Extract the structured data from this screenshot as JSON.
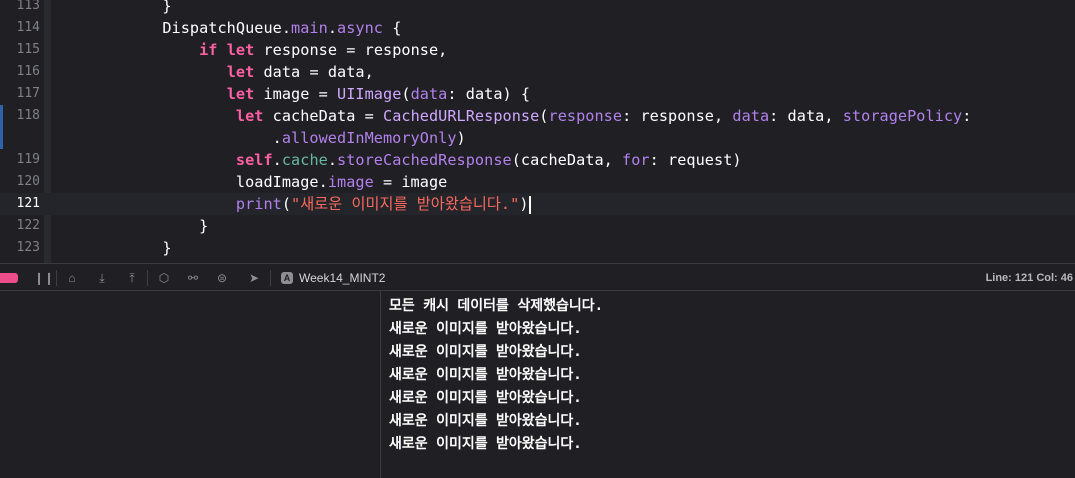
{
  "editor": {
    "lines": [
      {
        "number": "113",
        "tokens": [
          {
            "t": "            }",
            "c": "pl"
          }
        ]
      },
      {
        "number": "114",
        "tokens": [
          {
            "t": "            DispatchQueue",
            "c": "pl"
          },
          {
            "t": ".",
            "c": "pl"
          },
          {
            "t": "main",
            "c": "fn"
          },
          {
            "t": ".",
            "c": "pl"
          },
          {
            "t": "async",
            "c": "fn"
          },
          {
            "t": " {",
            "c": "pl"
          }
        ]
      },
      {
        "number": "115",
        "tokens": [
          {
            "t": "                ",
            "c": "pl"
          },
          {
            "t": "if",
            "c": "kw"
          },
          {
            "t": " ",
            "c": "pl"
          },
          {
            "t": "let",
            "c": "kw"
          },
          {
            "t": " response = response,",
            "c": "pl"
          }
        ]
      },
      {
        "number": "116",
        "tokens": [
          {
            "t": "                   ",
            "c": "pl"
          },
          {
            "t": "let",
            "c": "kw"
          },
          {
            "t": " data = data,",
            "c": "pl"
          }
        ]
      },
      {
        "number": "117",
        "tokens": [
          {
            "t": "                   ",
            "c": "pl"
          },
          {
            "t": "let",
            "c": "kw"
          },
          {
            "t": " image = ",
            "c": "pl"
          },
          {
            "t": "UIImage",
            "c": "ty"
          },
          {
            "t": "(",
            "c": "pl"
          },
          {
            "t": "data",
            "c": "fn"
          },
          {
            "t": ": data) {",
            "c": "pl"
          }
        ]
      },
      {
        "number": "118",
        "tokens": [
          {
            "t": "                    ",
            "c": "pl"
          },
          {
            "t": "let",
            "c": "kw"
          },
          {
            "t": " cacheData = ",
            "c": "pl"
          },
          {
            "t": "CachedURLResponse",
            "c": "ty"
          },
          {
            "t": "(",
            "c": "pl"
          },
          {
            "t": "response",
            "c": "fn"
          },
          {
            "t": ": response, ",
            "c": "pl"
          },
          {
            "t": "data",
            "c": "fn"
          },
          {
            "t": ": data, ",
            "c": "pl"
          },
          {
            "t": "storagePolicy",
            "c": "fn"
          },
          {
            "t": ":",
            "c": "pl"
          }
        ]
      },
      {
        "number": "",
        "tokens": [
          {
            "t": "                        .",
            "c": "pl"
          },
          {
            "t": "allowedInMemoryOnly",
            "c": "fn"
          },
          {
            "t": ")",
            "c": "pl"
          }
        ]
      },
      {
        "number": "119",
        "tokens": [
          {
            "t": "                    ",
            "c": "pl"
          },
          {
            "t": "self",
            "c": "kw"
          },
          {
            "t": ".",
            "c": "pl"
          },
          {
            "t": "cache",
            "c": "prop"
          },
          {
            "t": ".",
            "c": "pl"
          },
          {
            "t": "storeCachedResponse",
            "c": "fn"
          },
          {
            "t": "(cacheData, ",
            "c": "pl"
          },
          {
            "t": "for",
            "c": "fn"
          },
          {
            "t": ": request)",
            "c": "pl"
          }
        ]
      },
      {
        "number": "120",
        "tokens": [
          {
            "t": "                    loadImage.",
            "c": "pl"
          },
          {
            "t": "image",
            "c": "fn"
          },
          {
            "t": " = image",
            "c": "pl"
          }
        ]
      },
      {
        "number": "121",
        "tokens": [
          {
            "t": "                    ",
            "c": "pl"
          },
          {
            "t": "print",
            "c": "fn"
          },
          {
            "t": "(",
            "c": "pl"
          },
          {
            "t": "\"새로운 이미지를 받아왔습니다.\"",
            "c": "str"
          },
          {
            "t": ")",
            "c": "pl"
          }
        ],
        "current": true
      },
      {
        "number": "122",
        "tokens": [
          {
            "t": "                }",
            "c": "pl"
          }
        ]
      },
      {
        "number": "123",
        "tokens": [
          {
            "t": "            }",
            "c": "pl"
          }
        ]
      }
    ]
  },
  "debug_bar": {
    "target_icon": "A",
    "target_label": "Week14_MINT2",
    "line_label": "Line: 121",
    "col_label": "Col: 46"
  },
  "console": {
    "lines": [
      "모든 캐시 데이터를 삭제했습니다.",
      "새로운 이미지를 받아왔습니다.",
      "새로운 이미지를 받아왔습니다.",
      "새로운 이미지를 받아왔습니다.",
      "새로운 이미지를 받아왔습니다.",
      "새로운 이미지를 받아왔습니다.",
      "새로운 이미지를 받아왔습니다."
    ]
  },
  "colors": {
    "background": "#1f1f24",
    "keyword": "#fc5fa3",
    "function": "#b281eb",
    "string": "#fc6a5d",
    "property": "#67b7a4",
    "breakpoint": "#ec4e8b",
    "current_line": "#23252b"
  }
}
